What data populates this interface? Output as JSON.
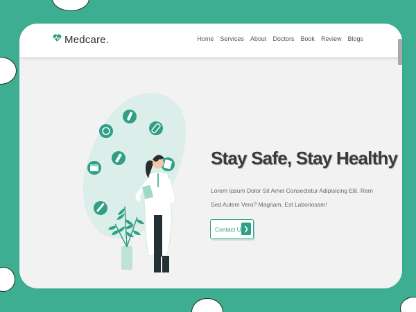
{
  "colors": {
    "accent": "#2f9f85",
    "page_background": "#3eae93",
    "card_background": "#f2f2f2"
  },
  "brand": {
    "logo_icon": "heart-pulse-icon",
    "name": "Medcare."
  },
  "nav": {
    "items": [
      "Home",
      "Services",
      "About",
      "Doctors",
      "Book",
      "Review",
      "Blogs"
    ]
  },
  "hero": {
    "title": "Stay Safe, Stay Healthy",
    "text": "Lorem Ipsum Dolor Sit Amet Consectetur Adipisicing Elit. Rem Sed Autem Vero? Magnam, Est Laboriosam!",
    "cta_label": "Contact Us",
    "cta_icon": "chevron-right-icon",
    "illustration": "doctor-with-medical-icons-illustration"
  }
}
